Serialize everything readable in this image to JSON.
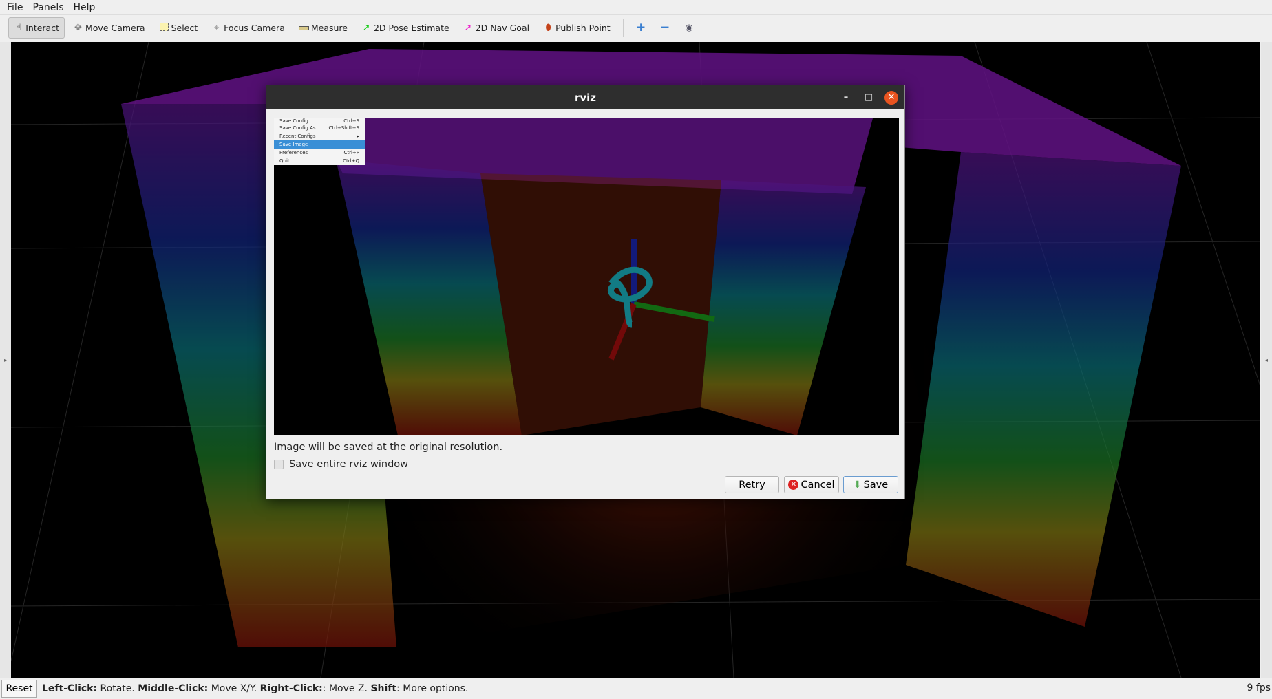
{
  "menu": {
    "file": "File",
    "panels": "Panels",
    "help": "Help"
  },
  "toolbar": {
    "tools": [
      {
        "label": "Interact",
        "icon": "hand-icon"
      },
      {
        "label": "Move Camera",
        "icon": "move-camera-icon"
      },
      {
        "label": "Select",
        "icon": "select-icon"
      },
      {
        "label": "Focus Camera",
        "icon": "focus-camera-icon"
      },
      {
        "label": "Measure",
        "icon": "ruler-icon"
      },
      {
        "label": "2D Pose Estimate",
        "icon": "green-arrow-icon"
      },
      {
        "label": "2D Nav Goal",
        "icon": "pink-arrow-icon"
      },
      {
        "label": "Publish Point",
        "icon": "map-pin-icon"
      }
    ]
  },
  "dialog": {
    "title": "rviz",
    "preview_menu": [
      {
        "label": "Save Config",
        "shortcut": "Ctrl+S"
      },
      {
        "label": "Save Config As",
        "shortcut": "Ctrl+Shift+S"
      },
      {
        "label": "Recent Configs",
        "shortcut": "▸"
      },
      {
        "label": "Save Image",
        "shortcut": ""
      },
      {
        "label": "Preferences",
        "shortcut": "Ctrl+P"
      },
      {
        "label": "Quit",
        "shortcut": "Ctrl+Q"
      }
    ],
    "info": "Image will be saved at the original resolution.",
    "checkbox_label": "Save entire rviz window",
    "checkbox_checked": false,
    "retry": "Retry",
    "cancel": "Cancel",
    "save": "Save"
  },
  "status": {
    "reset": "Reset",
    "hint_parts": [
      {
        "b": "Left-Click:",
        "t": " Rotate. "
      },
      {
        "b": "Middle-Click:",
        "t": " Move X/Y. "
      },
      {
        "b": "Right-Click:",
        "t": ": Move Z. "
      },
      {
        "b": "Shift",
        "t": ": More options."
      }
    ],
    "fps": "9 fps"
  },
  "colors": {
    "accent": "#e95420",
    "selection": "#3a8fd6"
  }
}
